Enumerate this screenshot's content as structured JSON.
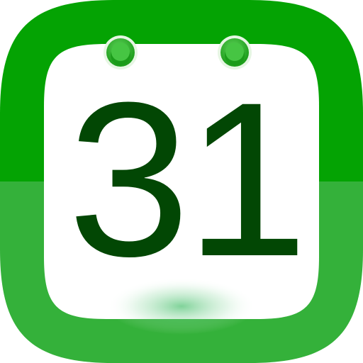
{
  "app_icon": {
    "icon_name": "calendar-icon",
    "day_number": "31",
    "colors": {
      "frame_top": "#04a303",
      "frame_bottom": "#34b13a",
      "paper": "#ffffff",
      "ring": "#2fb52b",
      "ring_hole": "#0f8a0f",
      "digits": "#024704",
      "shadow": "#3bbb62"
    }
  }
}
